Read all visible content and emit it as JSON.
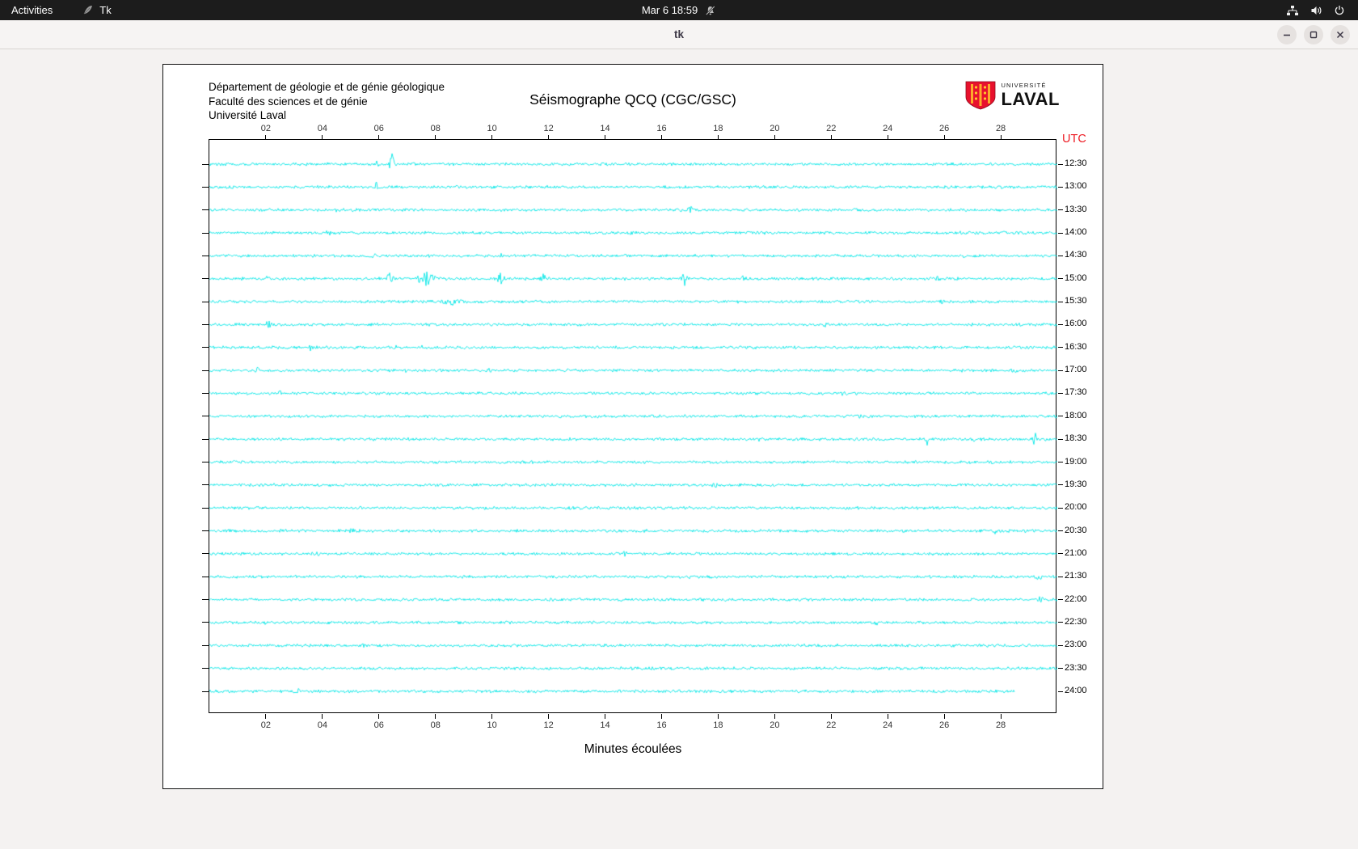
{
  "top_bar": {
    "activities_label": "Activities",
    "app_indicator_label": "Tk",
    "clock_label": "Mar 6 18:59"
  },
  "titlebar": {
    "window_title": "tk"
  },
  "header": {
    "org_lines": [
      "Département de géologie et de génie géologique",
      "Faculté des sciences et de génie",
      "Université Laval"
    ],
    "logo": {
      "small": "UNIVERSITÉ",
      "large": "LAVAL",
      "red": "#E8112D",
      "gold": "#FFC72C"
    }
  },
  "chart_data": {
    "type": "line",
    "title": "Séismographe QCQ (CGC/GSC)",
    "xlabel": "Minutes écoulées",
    "utc_label": "UTC",
    "utc_color": "#ED1C24",
    "trace_color": "#00E6E6",
    "x_range": [
      0,
      30
    ],
    "x_ticks": [
      "02",
      "04",
      "06",
      "08",
      "10",
      "12",
      "14",
      "16",
      "18",
      "20",
      "22",
      "24",
      "26",
      "28"
    ],
    "noise_amp": 1.5,
    "rows": [
      {
        "label": "12:30",
        "events": [
          {
            "m": 5.95,
            "a": 3,
            "w": 0.05
          },
          {
            "m": 6.45,
            "a": 16,
            "w": 0.06
          }
        ]
      },
      {
        "label": "13:00",
        "events": [
          {
            "m": 0.8,
            "a": 3,
            "w": 0.08
          },
          {
            "m": 5.9,
            "a": 5,
            "w": 0.05
          }
        ]
      },
      {
        "label": "13:30",
        "events": [
          {
            "m": 4.5,
            "a": 2,
            "w": 0.05
          },
          {
            "m": 17.0,
            "a": 3,
            "w": 0.12
          },
          {
            "m": 22.9,
            "a": 2,
            "w": 0.08
          }
        ]
      },
      {
        "label": "14:00",
        "events": [
          {
            "m": 4.2,
            "a": 3,
            "w": 0.1
          },
          {
            "m": 14.9,
            "a": 2,
            "w": 0.06
          },
          {
            "m": 26.6,
            "a": 2,
            "w": 0.06
          }
        ]
      },
      {
        "label": "14:30",
        "events": [
          {
            "m": 5.8,
            "a": 4,
            "w": 0.06
          },
          {
            "m": 10.3,
            "a": 4,
            "w": 0.05
          },
          {
            "m": 26.7,
            "a": 2,
            "w": 0.05
          }
        ]
      },
      {
        "label": "15:00",
        "events": [
          {
            "m": 2.0,
            "a": 3,
            "w": 0.08
          },
          {
            "m": 6.4,
            "a": 8,
            "w": 0.1
          },
          {
            "m": 7.7,
            "a": 9,
            "w": 0.25
          },
          {
            "m": 10.3,
            "a": 7,
            "w": 0.1
          },
          {
            "m": 11.8,
            "a": 6,
            "w": 0.08
          },
          {
            "m": 16.8,
            "a": 7,
            "w": 0.1
          },
          {
            "m": 18.9,
            "a": 4,
            "w": 0.08
          },
          {
            "m": 25.8,
            "a": 3,
            "w": 0.06
          }
        ]
      },
      {
        "label": "15:30",
        "events": [
          {
            "m": 8.6,
            "a": 4,
            "w": 0.3
          },
          {
            "m": 25.9,
            "a": 2,
            "w": 0.06
          }
        ]
      },
      {
        "label": "16:00",
        "events": [
          {
            "m": 2.1,
            "a": 3,
            "w": 0.1
          },
          {
            "m": 21.8,
            "a": 2,
            "w": 0.08
          }
        ]
      },
      {
        "label": "16:30",
        "events": [
          {
            "m": 3.6,
            "a": 3,
            "w": 0.07
          },
          {
            "m": 6.6,
            "a": 2,
            "w": 0.08
          },
          {
            "m": 7.5,
            "a": 2,
            "w": 0.06
          }
        ]
      },
      {
        "label": "17:00",
        "events": [
          {
            "m": 1.7,
            "a": 2,
            "w": 0.06
          },
          {
            "m": 7.0,
            "a": 2,
            "w": 0.06
          },
          {
            "m": 9.9,
            "a": 2,
            "w": 0.08
          },
          {
            "m": 26.7,
            "a": 2,
            "w": 0.05
          },
          {
            "m": 28.5,
            "a": 2,
            "w": 0.05
          }
        ]
      },
      {
        "label": "17:30",
        "events": [
          {
            "m": 2.5,
            "a": 2,
            "w": 0.06
          },
          {
            "m": 22.4,
            "a": 2,
            "w": 0.06
          }
        ]
      },
      {
        "label": "18:00",
        "events": [
          {
            "m": 23.0,
            "a": 2,
            "w": 0.06
          }
        ]
      },
      {
        "label": "18:30",
        "events": [
          {
            "m": 19.5,
            "a": 4,
            "w": 0.05
          },
          {
            "m": 25.4,
            "a": 8,
            "w": 0.05
          },
          {
            "m": 27.0,
            "a": 7,
            "w": 0.05
          },
          {
            "m": 29.2,
            "a": 9,
            "w": 0.05
          }
        ]
      },
      {
        "label": "19:00",
        "events": [
          {
            "m": 8.8,
            "a": 3,
            "w": 0.07
          },
          {
            "m": 27.7,
            "a": 2,
            "w": 0.05
          }
        ]
      },
      {
        "label": "19:30",
        "events": [
          {
            "m": 2.3,
            "a": 2,
            "w": 0.06
          },
          {
            "m": 17.9,
            "a": 2,
            "w": 0.08
          }
        ]
      },
      {
        "label": "20:00",
        "events": [
          {
            "m": 25.8,
            "a": 2,
            "w": 0.08
          }
        ]
      },
      {
        "label": "20:30",
        "events": [
          {
            "m": 5.0,
            "a": 2,
            "w": 0.1
          },
          {
            "m": 27.8,
            "a": 2,
            "w": 0.1
          }
        ]
      },
      {
        "label": "21:00",
        "events": [
          {
            "m": 3.8,
            "a": 2,
            "w": 0.1
          },
          {
            "m": 14.7,
            "a": 2,
            "w": 0.06
          }
        ]
      },
      {
        "label": "21:30",
        "events": [
          {
            "m": 17.0,
            "a": 2,
            "w": 0.06
          },
          {
            "m": 29.3,
            "a": 3,
            "w": 0.15
          }
        ]
      },
      {
        "label": "22:00",
        "events": [
          {
            "m": 12.2,
            "a": 2,
            "w": 0.06
          },
          {
            "m": 29.4,
            "a": 4,
            "w": 0.08
          }
        ]
      },
      {
        "label": "22:30",
        "events": [
          {
            "m": 2.0,
            "a": 2,
            "w": 0.08
          },
          {
            "m": 7.3,
            "a": 2,
            "w": 0.1
          },
          {
            "m": 23.6,
            "a": 2,
            "w": 0.06
          }
        ]
      },
      {
        "label": "23:00",
        "events": [
          {
            "m": 5.5,
            "a": 2,
            "w": 0.06
          },
          {
            "m": 24.5,
            "a": 2,
            "w": 0.06
          }
        ]
      },
      {
        "label": "23:30",
        "events": [
          {
            "m": 21.0,
            "a": 2,
            "w": 0.06
          }
        ]
      },
      {
        "label": "24:00",
        "events": [
          {
            "m": 3.1,
            "a": 3,
            "w": 0.08
          }
        ],
        "end": 28.5
      }
    ]
  }
}
